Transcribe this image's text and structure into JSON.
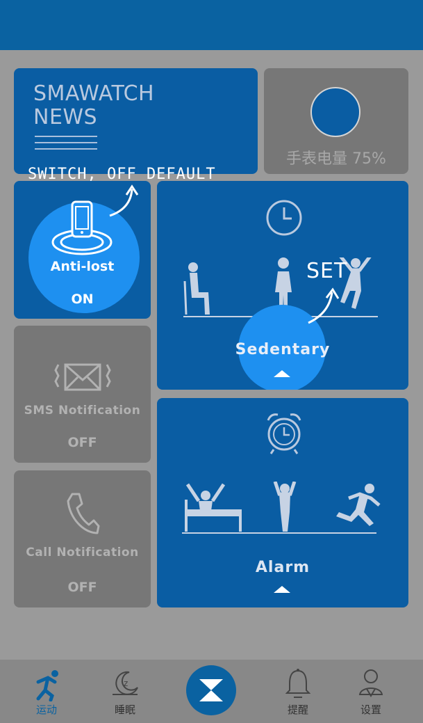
{
  "news": {
    "title_line1": "SMAWATCH",
    "title_line2": "NEWS"
  },
  "battery": {
    "label": "手表电量 75%",
    "level_percent": 75
  },
  "anti_lost": {
    "name": "Anti-lost",
    "state": "ON"
  },
  "sms": {
    "name": "SMS Notification",
    "state": "OFF"
  },
  "call": {
    "name": "Call Notification",
    "state": "OFF"
  },
  "sedentary": {
    "name": "Sedentary"
  },
  "alarm": {
    "name": "Alarm"
  },
  "annotations": {
    "switch_note": "SWITCH, OFF DEFAULT",
    "set_note": "SET"
  },
  "nav": {
    "items": [
      {
        "label": "运动",
        "icon": "runner-icon",
        "active": true
      },
      {
        "label": "睡眠",
        "icon": "moon-icon",
        "active": false
      },
      {
        "label": "",
        "icon": "hourglass-icon",
        "active": false
      },
      {
        "label": "提醒",
        "icon": "bell-icon",
        "active": false
      },
      {
        "label": "设置",
        "icon": "settings-person-icon",
        "active": false
      }
    ]
  },
  "colors": {
    "primary_blue": "#0a5da3",
    "highlight_blue": "#1e90f0",
    "disabled_grey": "#777777",
    "background": "#9a9a9a"
  }
}
